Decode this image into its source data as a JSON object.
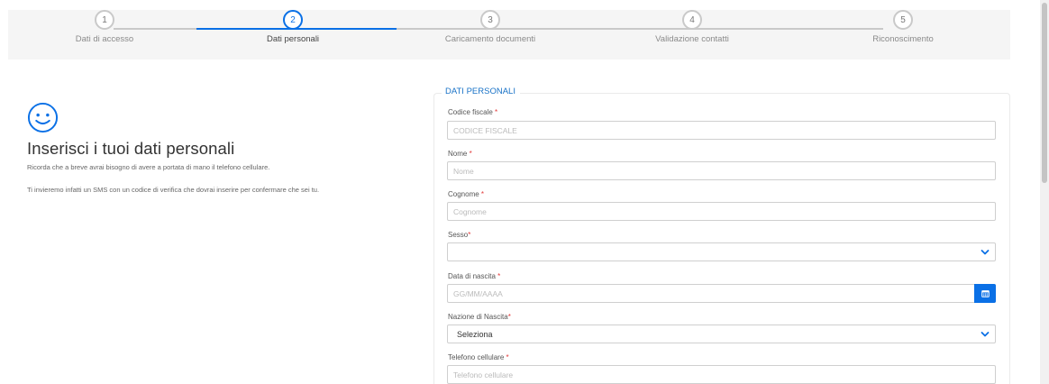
{
  "stepper": {
    "steps": [
      {
        "number": "1",
        "label": "Dati di accesso",
        "active": false
      },
      {
        "number": "2",
        "label": "Dati personali",
        "active": true
      },
      {
        "number": "3",
        "label": "Caricamento documenti",
        "active": false
      },
      {
        "number": "4",
        "label": "Validazione contatti",
        "active": false
      },
      {
        "number": "5",
        "label": "Riconoscimento",
        "active": false
      }
    ],
    "colors": {
      "active": "#0a70e6",
      "inactive": "#c9c9c9"
    }
  },
  "intro": {
    "icon": "smiley-icon",
    "title": "Inserisci i tuoi dati personali",
    "paragraph1": "Ricorda che a breve avrai bisogno di avere a portata di mano il telefono cellulare.",
    "paragraph2": "Ti invieremo infatti un SMS con un codice di verifica che dovrai inserire per confermare che sei tu."
  },
  "form": {
    "legend": "DATI PERSONALI",
    "required_mark": "*",
    "fields": {
      "codice_fiscale": {
        "label": "Codice fiscale ",
        "placeholder": "CODICE FISCALE"
      },
      "nome": {
        "label": "Nome ",
        "placeholder": "Nome"
      },
      "cognome": {
        "label": "Cognome ",
        "placeholder": "Cognome"
      },
      "sesso": {
        "label": "Sesso",
        "value": ""
      },
      "data_nascita": {
        "label": "Data di nascita ",
        "placeholder": "GG/MM/AAAA"
      },
      "nazione_nascita": {
        "label": "Nazione di Nascita",
        "value": "Seleziona"
      },
      "telefono": {
        "label": "Telefono cellulare ",
        "placeholder": "Telefono cellulare"
      }
    }
  }
}
